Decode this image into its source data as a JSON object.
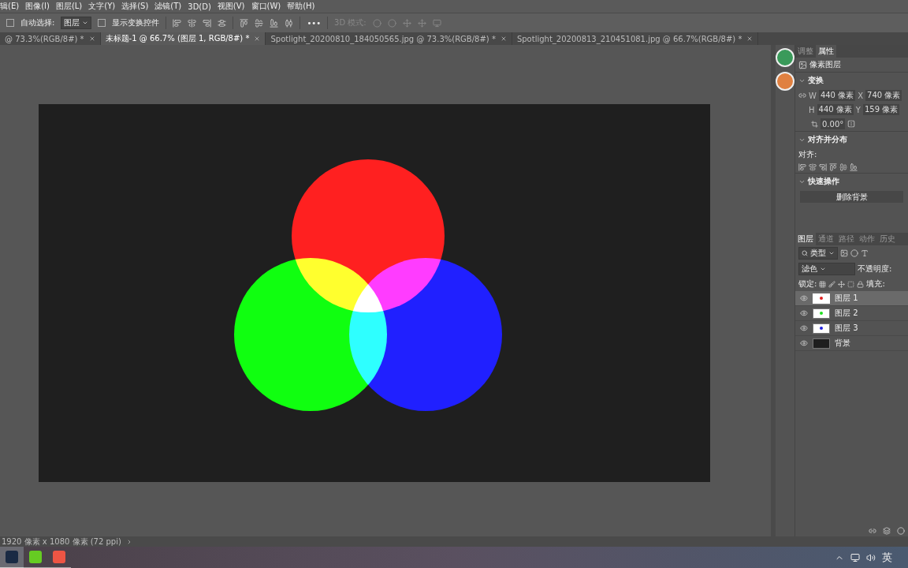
{
  "menu": [
    "辑(E)",
    "图像(I)",
    "图层(L)",
    "文字(Y)",
    "选择(S)",
    "滤镜(T)",
    "3D(D)",
    "视图(V)",
    "窗口(W)",
    "帮助(H)"
  ],
  "options": {
    "auto_select": {
      "label": "自动选择:",
      "checked": false
    },
    "target": "图层",
    "show_transform": {
      "label": "显示变换控件",
      "checked": false
    },
    "more": "•••",
    "mode_3d": {
      "label": "3D 模式:",
      "disabled": true
    }
  },
  "tabs": [
    {
      "label": "@ 73.3%(RGB/8#) *",
      "selected": false
    },
    {
      "label": "未标题-1 @ 66.7% (图层 1, RGB/8#) *",
      "selected": true
    },
    {
      "label": "Spotlight_20200810_184050565.jpg @ 73.3%(RGB/8#) *",
      "selected": false
    },
    {
      "label": "Spotlight_20200813_210451081.jpg @ 66.7%(RGB/8#) *",
      "selected": false
    }
  ],
  "properties": {
    "tabs": [
      {
        "label": "调整",
        "selected": false
      },
      {
        "label": "属性",
        "selected": true
      }
    ],
    "layer_kind": "像素图层",
    "transform": {
      "title": "变换",
      "expanded": true,
      "w_label": "W",
      "h_label": "H",
      "x_label": "X",
      "y_label": "Y",
      "w": "440 像素",
      "h": "440 像素",
      "x": "740 像素",
      "y": "159 像素",
      "angle": "0.00°"
    },
    "align": {
      "title": "对齐并分布",
      "expanded": true,
      "label": "对齐:"
    },
    "quick": {
      "title": "快速操作",
      "expanded": true,
      "button": "删除背景"
    }
  },
  "layers_panel": {
    "tabs": [
      {
        "label": "图层",
        "selected": true
      },
      {
        "label": "通道",
        "selected": false
      },
      {
        "label": "路径",
        "selected": false
      },
      {
        "label": "动作",
        "selected": false
      },
      {
        "label": "历史",
        "selected": false
      }
    ],
    "filter": "类型",
    "blend": "滤色",
    "opacity_label": "不透明度:",
    "lock_label": "锁定:",
    "fill_label": "填充:",
    "layers": [
      {
        "name": "图层 1",
        "visible": true,
        "selected": true,
        "kind": "dot",
        "color": "#e02020"
      },
      {
        "name": "图层 2",
        "visible": true,
        "selected": false,
        "kind": "dot",
        "color": "#20e020"
      },
      {
        "name": "图层 3",
        "visible": true,
        "selected": false,
        "kind": "dot",
        "color": "#2020e0"
      },
      {
        "name": "背景",
        "visible": true,
        "selected": false,
        "kind": "fill",
        "color": "#1e1e1e"
      }
    ]
  },
  "status": "1920 像素 x 1080 像素 (72 ppi)",
  "taskbar": {
    "apps": [
      {
        "selected": true,
        "color": "#1a2a44"
      },
      {
        "selected": false,
        "color": "#66cc22"
      },
      {
        "selected": false,
        "color": "#ee5544"
      }
    ],
    "ime": "英"
  }
}
